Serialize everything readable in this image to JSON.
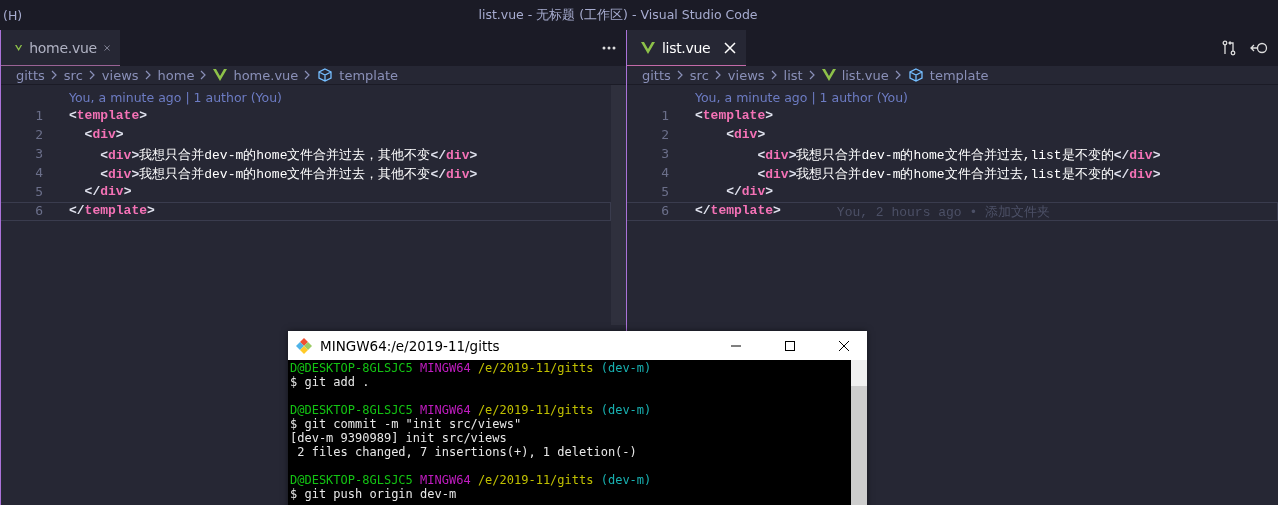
{
  "title_bar": {
    "menu_fragment": "(H)",
    "title": "list.vue - 无标题 (工作区) - Visual Studio Code"
  },
  "editor_groups": [
    {
      "tab": {
        "label": "home.vue",
        "focused": false
      },
      "breadcrumbs": [
        {
          "label": "gitts",
          "kind": "folder"
        },
        {
          "label": "src",
          "kind": "folder"
        },
        {
          "label": "views",
          "kind": "folder"
        },
        {
          "label": "home",
          "kind": "folder"
        },
        {
          "label": "home.vue",
          "kind": "vue"
        },
        {
          "label": "template",
          "kind": "symbol"
        }
      ],
      "blame_header": "You, a minute ago | 1 author (You)",
      "lines": [
        {
          "number": "1",
          "current": false,
          "tokens": [
            {
              "kind": "punct",
              "text": "<"
            },
            {
              "kind": "tag",
              "text": "template"
            },
            {
              "kind": "punct",
              "text": ">"
            }
          ]
        },
        {
          "number": "2",
          "current": false,
          "tokens": [
            {
              "kind": "punct",
              "text": "  <"
            },
            {
              "kind": "tag",
              "text": "div"
            },
            {
              "kind": "punct",
              "text": ">"
            }
          ]
        },
        {
          "number": "3",
          "current": false,
          "tokens": [
            {
              "kind": "punct",
              "text": "    <"
            },
            {
              "kind": "tag",
              "text": "div"
            },
            {
              "kind": "punct",
              "text": ">"
            },
            {
              "kind": "text",
              "text": "我想只合并dev-m的home文件合并过去，其他不变"
            },
            {
              "kind": "punct",
              "text": "</"
            },
            {
              "kind": "tag",
              "text": "div"
            },
            {
              "kind": "punct",
              "text": ">"
            }
          ]
        },
        {
          "number": "4",
          "current": false,
          "tokens": [
            {
              "kind": "punct",
              "text": "    <"
            },
            {
              "kind": "tag",
              "text": "div"
            },
            {
              "kind": "punct",
              "text": ">"
            },
            {
              "kind": "text",
              "text": "我想只合并dev-m的home文件合并过去，其他不变"
            },
            {
              "kind": "punct",
              "text": "</"
            },
            {
              "kind": "tag",
              "text": "div"
            },
            {
              "kind": "punct",
              "text": ">"
            }
          ]
        },
        {
          "number": "5",
          "current": false,
          "tokens": [
            {
              "kind": "punct",
              "text": "  </"
            },
            {
              "kind": "tag",
              "text": "div"
            },
            {
              "kind": "punct",
              "text": ">"
            }
          ]
        },
        {
          "number": "6",
          "current": true,
          "tokens": [
            {
              "kind": "punct",
              "text": "</"
            },
            {
              "kind": "tag",
              "text": "template"
            },
            {
              "kind": "punct",
              "text": ">"
            }
          ]
        }
      ]
    },
    {
      "tab": {
        "label": "list.vue",
        "focused": true
      },
      "breadcrumbs": [
        {
          "label": "gitts",
          "kind": "folder"
        },
        {
          "label": "src",
          "kind": "folder"
        },
        {
          "label": "views",
          "kind": "folder"
        },
        {
          "label": "list",
          "kind": "folder"
        },
        {
          "label": "list.vue",
          "kind": "vue"
        },
        {
          "label": "template",
          "kind": "symbol"
        }
      ],
      "blame_header": "You, a minute ago | 1 author (You)",
      "lines": [
        {
          "number": "1",
          "current": false,
          "tokens": [
            {
              "kind": "punct",
              "text": "<"
            },
            {
              "kind": "tag",
              "text": "template"
            },
            {
              "kind": "punct",
              "text": ">"
            }
          ]
        },
        {
          "number": "2",
          "current": false,
          "tokens": [
            {
              "kind": "punct",
              "text": "    <"
            },
            {
              "kind": "tag",
              "text": "div"
            },
            {
              "kind": "punct",
              "text": ">"
            }
          ]
        },
        {
          "number": "3",
          "current": false,
          "tokens": [
            {
              "kind": "punct",
              "text": "        <"
            },
            {
              "kind": "tag",
              "text": "div"
            },
            {
              "kind": "punct",
              "text": ">"
            },
            {
              "kind": "text",
              "text": "我想只合并dev-m的home文件合并过去,list是不变的"
            },
            {
              "kind": "punct",
              "text": "</"
            },
            {
              "kind": "tag",
              "text": "div"
            },
            {
              "kind": "punct",
              "text": ">"
            }
          ]
        },
        {
          "number": "4",
          "current": false,
          "tokens": [
            {
              "kind": "punct",
              "text": "        <"
            },
            {
              "kind": "tag",
              "text": "div"
            },
            {
              "kind": "punct",
              "text": ">"
            },
            {
              "kind": "text",
              "text": "我想只合并dev-m的home文件合并过去,list是不变的"
            },
            {
              "kind": "punct",
              "text": "</"
            },
            {
              "kind": "tag",
              "text": "div"
            },
            {
              "kind": "punct",
              "text": ">"
            }
          ]
        },
        {
          "number": "5",
          "current": false,
          "tokens": [
            {
              "kind": "punct",
              "text": "    </"
            },
            {
              "kind": "tag",
              "text": "div"
            },
            {
              "kind": "punct",
              "text": ">"
            }
          ]
        },
        {
          "number": "6",
          "current": true,
          "tokens": [
            {
              "kind": "punct",
              "text": "</"
            },
            {
              "kind": "tag",
              "text": "template"
            },
            {
              "kind": "punct",
              "text": ">"
            }
          ],
          "annotation": "You, 2 hours ago • 添加文件夹"
        }
      ]
    }
  ],
  "terminal": {
    "title": "MINGW64:/e/2019-11/gitts",
    "blocks": [
      [
        [
          {
            "kind": "user",
            "text": "D@DESKTOP-8GLSJC5"
          },
          {
            "kind": "host",
            "text": "MINGW64"
          },
          {
            "kind": "path",
            "text": "/e/2019-11/gitts"
          },
          {
            "kind": "branch",
            "text": "(dev-m)"
          }
        ],
        [
          {
            "kind": "output",
            "text": "$ git add ."
          }
        ]
      ],
      [
        [
          {
            "kind": "user",
            "text": "D@DESKTOP-8GLSJC5"
          },
          {
            "kind": "host",
            "text": "MINGW64"
          },
          {
            "kind": "path",
            "text": "/e/2019-11/gitts"
          },
          {
            "kind": "branch",
            "text": "(dev-m)"
          }
        ],
        [
          {
            "kind": "output",
            "text": "$ git commit -m \"init src/views\""
          }
        ],
        [
          {
            "kind": "output",
            "text": "[dev-m 9390989] init src/views"
          }
        ],
        [
          {
            "kind": "output",
            "text": " 2 files changed, 7 insertions(+), 1 deletion(-)"
          }
        ]
      ],
      [
        [
          {
            "kind": "user",
            "text": "D@DESKTOP-8GLSJC5"
          },
          {
            "kind": "host",
            "text": "MINGW64"
          },
          {
            "kind": "path",
            "text": "/e/2019-11/gitts"
          },
          {
            "kind": "branch",
            "text": "(dev-m)"
          }
        ],
        [
          {
            "kind": "output",
            "text": "$ git push origin dev-m"
          }
        ]
      ]
    ]
  }
}
